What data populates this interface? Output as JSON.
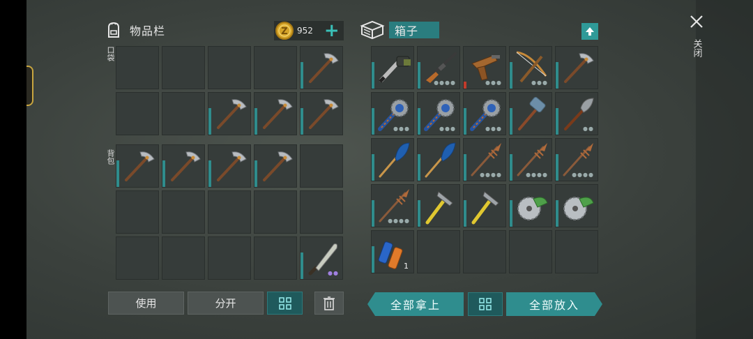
{
  "inventory": {
    "title": "物品栏",
    "currency": "952",
    "add_label": "+",
    "pocket_label": "口袋",
    "backpack_label": "背包"
  },
  "box": {
    "title": "箱子"
  },
  "buttons": {
    "use": "使用",
    "split": "分开",
    "take_all": "全部拿上",
    "put_all": "全部放入"
  },
  "close_label": "关闭",
  "pocket_slots": [
    {},
    {},
    {},
    {},
    {
      "item": "pickaxe-icon"
    },
    {},
    {},
    {
      "item": "pickaxe-icon"
    },
    {
      "item": "pickaxe-icon"
    },
    {
      "item": "pickaxe-icon"
    }
  ],
  "backpack_slots": [
    {
      "item": "pickaxe-icon"
    },
    {
      "item": "pickaxe-icon"
    },
    {
      "item": "pickaxe-icon"
    },
    {
      "item": "pickaxe-icon"
    },
    {},
    {},
    {},
    {},
    {},
    {},
    {},
    {},
    {},
    {},
    {
      "item": "machete-icon",
      "dots": "●●",
      "dots_color": "purple"
    }
  ],
  "box_slots": [
    {
      "item": "chainsaw-icon"
    },
    {
      "item": "rifle-icon",
      "dots": "●●●●"
    },
    {
      "item": "pistol-icon",
      "dots": "●●●",
      "bar": "red"
    },
    {
      "item": "crossbow-icon",
      "dots": "●●●"
    },
    {
      "item": "pickaxe-icon"
    },
    {
      "item": "spiked-club-icon",
      "dots": "●●●"
    },
    {
      "item": "spiked-club-icon",
      "dots": "●●●"
    },
    {
      "item": "spiked-club-icon",
      "dots": "●●●"
    },
    {
      "item": "sledgehammer-icon"
    },
    {
      "item": "shovel-icon",
      "dots": "●●"
    },
    {
      "item": "paddle-icon"
    },
    {
      "item": "paddle-icon"
    },
    {
      "item": "spear-icon",
      "dots": "●●●●"
    },
    {
      "item": "spear-icon",
      "dots": "●●●●"
    },
    {
      "item": "spear-icon",
      "dots": "●●●●"
    },
    {
      "item": "spear-icon",
      "dots": "●●●●"
    },
    {
      "item": "hammer-icon"
    },
    {
      "item": "hammer-icon"
    },
    {
      "item": "saw-blade-icon"
    },
    {
      "item": "saw-blade-icon"
    },
    {
      "item": "batteries-icon",
      "qty": "1"
    },
    {},
    {},
    {},
    {}
  ],
  "colors": {
    "accent": "#2f8d8e",
    "gold": "#d6a52a"
  }
}
